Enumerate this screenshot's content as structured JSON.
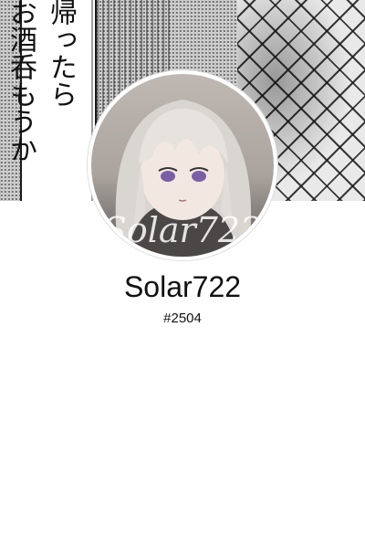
{
  "banner": {
    "bubble_text": "帰ったら\nお酒呑もうか"
  },
  "avatar": {
    "watermark": "Solar722"
  },
  "profile": {
    "username": "Solar722",
    "discriminator": "#2504"
  }
}
